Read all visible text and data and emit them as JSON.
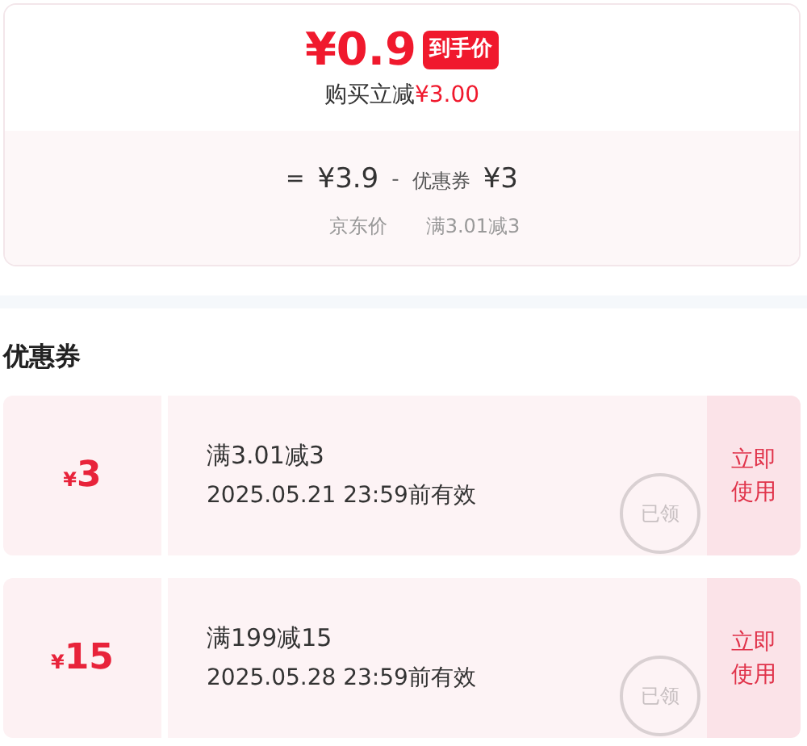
{
  "price_card": {
    "final_price": "¥0.9",
    "final_tag": "到手价",
    "discount_label": "购买立减",
    "discount_amount": "¥3.00",
    "equals": "=",
    "jd_price": "¥3.9",
    "minus": "-",
    "coupon_label": "优惠券",
    "coupon_amount": "¥3",
    "jd_price_caption": "京东价",
    "coupon_caption": "满3.01减3"
  },
  "coupons_title": "优惠券",
  "coupons": [
    {
      "currency": "¥",
      "amount": "3",
      "condition": "满3.01减3",
      "validity": "2025.05.21 23:59前有效",
      "stamp": "已领",
      "action": "立即使用"
    },
    {
      "currency": "¥",
      "amount": "15",
      "condition": "满199减15",
      "validity": "2025.05.28 23:59前有效",
      "stamp": "已领",
      "action": "立即使用"
    }
  ]
}
